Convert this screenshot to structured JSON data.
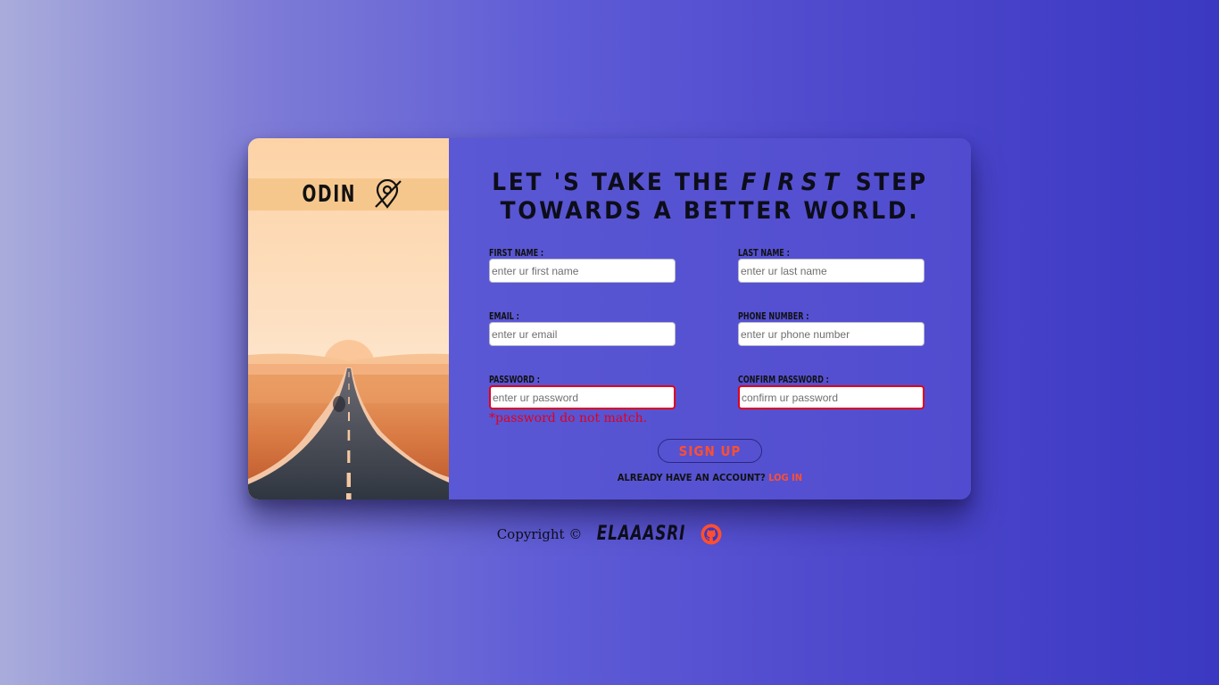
{
  "brand": {
    "logo_text": "ODIN",
    "logo_icon": "map-pin-off-icon"
  },
  "headline": {
    "before": "LET 'S TAKE THE ",
    "emphasis": "FIRST",
    "after": " STEP TOWARDS A BETTER WORLD."
  },
  "form": {
    "first_name": {
      "label": "First name :",
      "placeholder": "enter ur first name",
      "value": ""
    },
    "last_name": {
      "label": "Last name :",
      "placeholder": "enter ur last name",
      "value": ""
    },
    "email": {
      "label": "Email :",
      "placeholder": "enter ur email",
      "value": ""
    },
    "phone": {
      "label": "Phone number :",
      "placeholder": "enter ur phone number",
      "value": ""
    },
    "password": {
      "label": "Password :",
      "placeholder": "enter ur password",
      "value": ""
    },
    "confirm_password": {
      "label": "Confirm password :",
      "placeholder": "confirm ur password",
      "value": ""
    },
    "error_message": "*password do not match.",
    "submit_label": "Sign up",
    "login_prompt": "Already have an account?",
    "login_link": "Log in"
  },
  "footer": {
    "copyright": "Copyright ©",
    "author": "ELAAASRI",
    "github_icon": "github-icon"
  },
  "colors": {
    "accent": "#ff4f2f",
    "error": "#e0001c",
    "panel": "#5a58d4",
    "logo_band": "#f6c78d"
  }
}
